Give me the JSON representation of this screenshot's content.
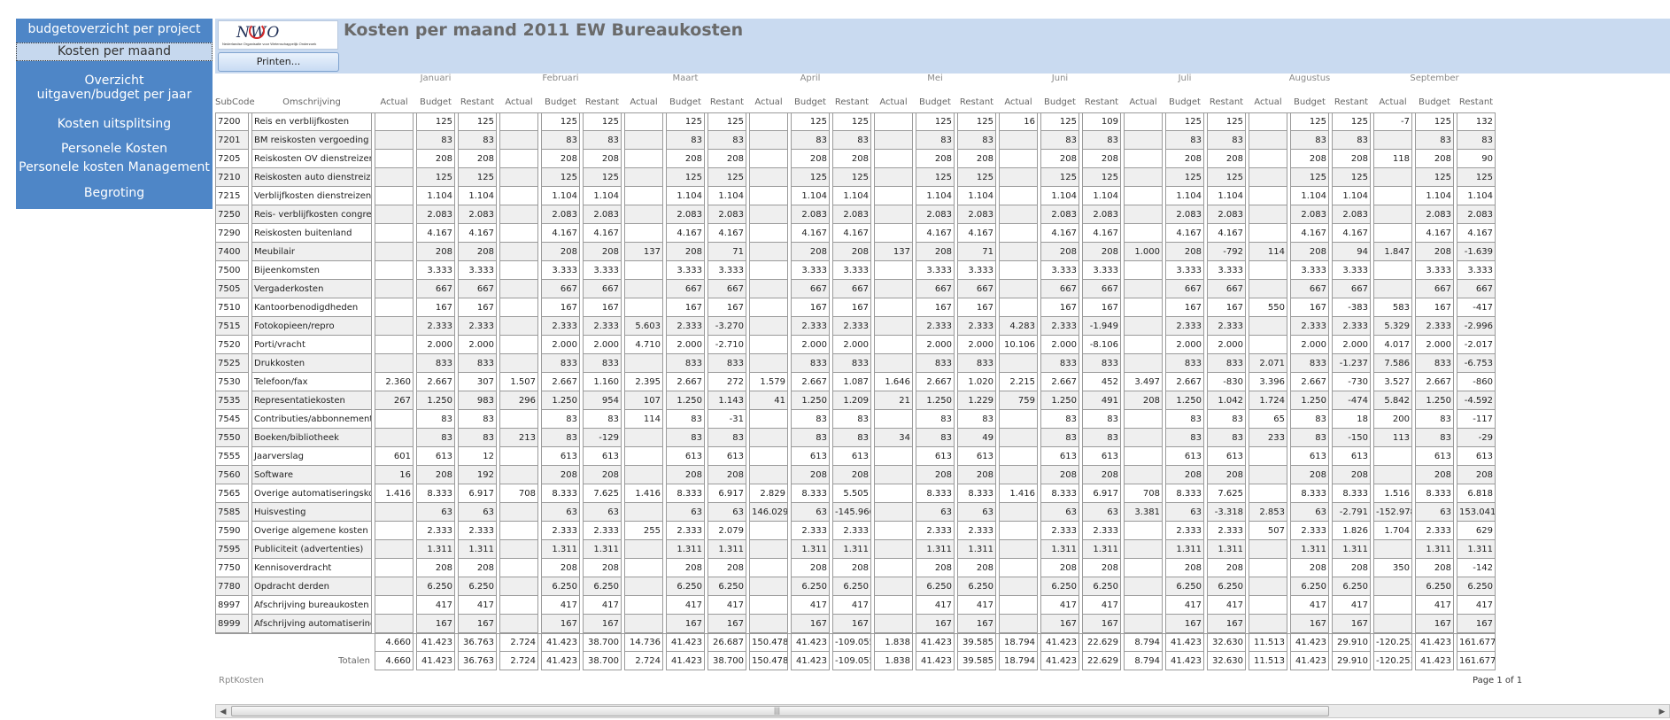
{
  "nav": {
    "items": [
      {
        "label": "budgetoverzicht per project",
        "active": false
      },
      {
        "label": "Kosten per maand",
        "active": true
      },
      {
        "label": "Overzicht uitgaven/budget per jaar",
        "active": false
      },
      {
        "label": "Kosten uitsplitsing",
        "active": false
      },
      {
        "label": "Personele Kosten",
        "active": false
      },
      {
        "label": "Personele kosten Management",
        "active": false
      },
      {
        "label": "Begroting",
        "active": false
      }
    ]
  },
  "header": {
    "logo_text": "NWO",
    "logo_subtitle": "Nederlandse Organisatie voor Wetenschappelijk Onderzoek",
    "title": "Kosten per maand 2011 EW Bureaukosten",
    "print_label": "Printen..."
  },
  "report": {
    "months": [
      "Januari",
      "Februari",
      "Maart",
      "April",
      "Mei",
      "Juni",
      "Juli",
      "Augustus",
      "September"
    ],
    "col_headers": {
      "subcode": "SubCode",
      "omschrijving": "Omschrijving",
      "actual": "Actual",
      "budget": "Budget",
      "restant": "Restant"
    },
    "rows": [
      {
        "code": "7200",
        "desc": "Reis en verblijfkosten",
        "v": [
          "",
          "125",
          "125",
          "",
          "125",
          "125",
          "",
          "125",
          "125",
          "",
          "125",
          "125",
          "",
          "125",
          "125",
          "16",
          "125",
          "109",
          "",
          "125",
          "125",
          "",
          "125",
          "125",
          "-7",
          "125",
          "132"
        ]
      },
      {
        "code": "7201",
        "desc": "BM reiskosten vergoeding",
        "v": [
          "",
          "83",
          "83",
          "",
          "83",
          "83",
          "",
          "83",
          "83",
          "",
          "83",
          "83",
          "",
          "83",
          "83",
          "",
          "83",
          "83",
          "",
          "83",
          "83",
          "",
          "83",
          "83",
          "",
          "83",
          "83"
        ]
      },
      {
        "code": "7205",
        "desc": "Reiskosten OV dienstreizen",
        "v": [
          "",
          "208",
          "208",
          "",
          "208",
          "208",
          "",
          "208",
          "208",
          "",
          "208",
          "208",
          "",
          "208",
          "208",
          "",
          "208",
          "208",
          "",
          "208",
          "208",
          "",
          "208",
          "208",
          "118",
          "208",
          "90"
        ]
      },
      {
        "code": "7210",
        "desc": "Reiskosten auto dienstreizen",
        "v": [
          "",
          "125",
          "125",
          "",
          "125",
          "125",
          "",
          "125",
          "125",
          "",
          "125",
          "125",
          "",
          "125",
          "125",
          "",
          "125",
          "125",
          "",
          "125",
          "125",
          "",
          "125",
          "125",
          "",
          "125",
          "125"
        ]
      },
      {
        "code": "7215",
        "desc": "Verblijfkosten dienstreizen",
        "v": [
          "",
          "1.104",
          "1.104",
          "",
          "1.104",
          "1.104",
          "",
          "1.104",
          "1.104",
          "",
          "1.104",
          "1.104",
          "",
          "1.104",
          "1.104",
          "",
          "1.104",
          "1.104",
          "",
          "1.104",
          "1.104",
          "",
          "1.104",
          "1.104",
          "",
          "1.104",
          "1.104"
        ]
      },
      {
        "code": "7250",
        "desc": "Reis- verblijfkosten congressen",
        "v": [
          "",
          "2.083",
          "2.083",
          "",
          "2.083",
          "2.083",
          "",
          "2.083",
          "2.083",
          "",
          "2.083",
          "2.083",
          "",
          "2.083",
          "2.083",
          "",
          "2.083",
          "2.083",
          "",
          "2.083",
          "2.083",
          "",
          "2.083",
          "2.083",
          "",
          "2.083",
          "2.083"
        ]
      },
      {
        "code": "7290",
        "desc": "Reiskosten buitenland",
        "v": [
          "",
          "4.167",
          "4.167",
          "",
          "4.167",
          "4.167",
          "",
          "4.167",
          "4.167",
          "",
          "4.167",
          "4.167",
          "",
          "4.167",
          "4.167",
          "",
          "4.167",
          "4.167",
          "",
          "4.167",
          "4.167",
          "",
          "4.167",
          "4.167",
          "",
          "4.167",
          "4.167"
        ]
      },
      {
        "code": "7400",
        "desc": "Meubilair",
        "v": [
          "",
          "208",
          "208",
          "",
          "208",
          "208",
          "137",
          "208",
          "71",
          "",
          "208",
          "208",
          "137",
          "208",
          "71",
          "",
          "208",
          "208",
          "1.000",
          "208",
          "-792",
          "114",
          "208",
          "94",
          "1.847",
          "208",
          "-1.639"
        ]
      },
      {
        "code": "7500",
        "desc": "Bijeenkomsten",
        "v": [
          "",
          "3.333",
          "3.333",
          "",
          "3.333",
          "3.333",
          "",
          "3.333",
          "3.333",
          "",
          "3.333",
          "3.333",
          "",
          "3.333",
          "3.333",
          "",
          "3.333",
          "3.333",
          "",
          "3.333",
          "3.333",
          "",
          "3.333",
          "3.333",
          "",
          "3.333",
          "3.333"
        ]
      },
      {
        "code": "7505",
        "desc": "Vergaderkosten",
        "v": [
          "",
          "667",
          "667",
          "",
          "667",
          "667",
          "",
          "667",
          "667",
          "",
          "667",
          "667",
          "",
          "667",
          "667",
          "",
          "667",
          "667",
          "",
          "667",
          "667",
          "",
          "667",
          "667",
          "",
          "667",
          "667"
        ]
      },
      {
        "code": "7510",
        "desc": "Kantoorbenodigdheden",
        "v": [
          "",
          "167",
          "167",
          "",
          "167",
          "167",
          "",
          "167",
          "167",
          "",
          "167",
          "167",
          "",
          "167",
          "167",
          "",
          "167",
          "167",
          "",
          "167",
          "167",
          "550",
          "167",
          "-383",
          "583",
          "167",
          "-417"
        ]
      },
      {
        "code": "7515",
        "desc": "Fotokopieen/repro",
        "v": [
          "",
          "2.333",
          "2.333",
          "",
          "2.333",
          "2.333",
          "5.603",
          "2.333",
          "-3.270",
          "",
          "2.333",
          "2.333",
          "",
          "2.333",
          "2.333",
          "4.283",
          "2.333",
          "-1.949",
          "",
          "2.333",
          "2.333",
          "",
          "2.333",
          "2.333",
          "5.329",
          "2.333",
          "-2.996"
        ]
      },
      {
        "code": "7520",
        "desc": "Porti/vracht",
        "v": [
          "",
          "2.000",
          "2.000",
          "",
          "2.000",
          "2.000",
          "4.710",
          "2.000",
          "-2.710",
          "",
          "2.000",
          "2.000",
          "",
          "2.000",
          "2.000",
          "10.106",
          "2.000",
          "-8.106",
          "",
          "2.000",
          "2.000",
          "",
          "2.000",
          "2.000",
          "4.017",
          "2.000",
          "-2.017"
        ]
      },
      {
        "code": "7525",
        "desc": "Drukkosten",
        "v": [
          "",
          "833",
          "833",
          "",
          "833",
          "833",
          "",
          "833",
          "833",
          "",
          "833",
          "833",
          "",
          "833",
          "833",
          "",
          "833",
          "833",
          "",
          "833",
          "833",
          "2.071",
          "833",
          "-1.237",
          "7.586",
          "833",
          "-6.753"
        ]
      },
      {
        "code": "7530",
        "desc": "Telefoon/fax",
        "v": [
          "2.360",
          "2.667",
          "307",
          "1.507",
          "2.667",
          "1.160",
          "2.395",
          "2.667",
          "272",
          "1.579",
          "2.667",
          "1.087",
          "1.646",
          "2.667",
          "1.020",
          "2.215",
          "2.667",
          "452",
          "3.497",
          "2.667",
          "-830",
          "3.396",
          "2.667",
          "-730",
          "3.527",
          "2.667",
          "-860"
        ]
      },
      {
        "code": "7535",
        "desc": "Representatiekosten",
        "v": [
          "267",
          "1.250",
          "983",
          "296",
          "1.250",
          "954",
          "107",
          "1.250",
          "1.143",
          "41",
          "1.250",
          "1.209",
          "21",
          "1.250",
          "1.229",
          "759",
          "1.250",
          "491",
          "208",
          "1.250",
          "1.042",
          "1.724",
          "1.250",
          "-474",
          "5.842",
          "1.250",
          "-4.592"
        ]
      },
      {
        "code": "7545",
        "desc": "Contributies/abbonnementen",
        "v": [
          "",
          "83",
          "83",
          "",
          "83",
          "83",
          "114",
          "83",
          "-31",
          "",
          "83",
          "83",
          "",
          "83",
          "83",
          "",
          "83",
          "83",
          "",
          "83",
          "83",
          "65",
          "83",
          "18",
          "200",
          "83",
          "-117"
        ]
      },
      {
        "code": "7550",
        "desc": "Boeken/bibliotheek",
        "v": [
          "",
          "83",
          "83",
          "213",
          "83",
          "-129",
          "",
          "83",
          "83",
          "",
          "83",
          "83",
          "34",
          "83",
          "49",
          "",
          "83",
          "83",
          "",
          "83",
          "83",
          "233",
          "83",
          "-150",
          "113",
          "83",
          "-29"
        ]
      },
      {
        "code": "7555",
        "desc": "Jaarverslag",
        "v": [
          "601",
          "613",
          "12",
          "",
          "613",
          "613",
          "",
          "613",
          "613",
          "",
          "613",
          "613",
          "",
          "613",
          "613",
          "",
          "613",
          "613",
          "",
          "613",
          "613",
          "",
          "613",
          "613",
          "",
          "613",
          "613"
        ]
      },
      {
        "code": "7560",
        "desc": "Software",
        "v": [
          "16",
          "208",
          "192",
          "",
          "208",
          "208",
          "",
          "208",
          "208",
          "",
          "208",
          "208",
          "",
          "208",
          "208",
          "",
          "208",
          "208",
          "",
          "208",
          "208",
          "",
          "208",
          "208",
          "",
          "208",
          "208"
        ]
      },
      {
        "code": "7565",
        "desc": "Overige automatiseringskosten",
        "v": [
          "1.416",
          "8.333",
          "6.917",
          "708",
          "8.333",
          "7.625",
          "1.416",
          "8.333",
          "6.917",
          "2.829",
          "8.333",
          "5.505",
          "",
          "8.333",
          "8.333",
          "1.416",
          "8.333",
          "6.917",
          "708",
          "8.333",
          "7.625",
          "",
          "8.333",
          "8.333",
          "1.516",
          "8.333",
          "6.818"
        ]
      },
      {
        "code": "7585",
        "desc": "Huisvesting",
        "v": [
          "",
          "63",
          "63",
          "",
          "63",
          "63",
          "",
          "63",
          "63",
          "146.029",
          "63",
          "-145.966",
          "",
          "63",
          "63",
          "",
          "63",
          "63",
          "3.381",
          "63",
          "-3.318",
          "2.853",
          "63",
          "-2.791",
          "-152.978",
          "63",
          "153.041"
        ]
      },
      {
        "code": "7590",
        "desc": "Overige algemene kosten",
        "v": [
          "",
          "2.333",
          "2.333",
          "",
          "2.333",
          "2.333",
          "255",
          "2.333",
          "2.079",
          "",
          "2.333",
          "2.333",
          "",
          "2.333",
          "2.333",
          "",
          "2.333",
          "2.333",
          "",
          "2.333",
          "2.333",
          "507",
          "2.333",
          "1.826",
          "1.704",
          "2.333",
          "629"
        ]
      },
      {
        "code": "7595",
        "desc": "Publiciteit (advertenties)",
        "v": [
          "",
          "1.311",
          "1.311",
          "",
          "1.311",
          "1.311",
          "",
          "1.311",
          "1.311",
          "",
          "1.311",
          "1.311",
          "",
          "1.311",
          "1.311",
          "",
          "1.311",
          "1.311",
          "",
          "1.311",
          "1.311",
          "",
          "1.311",
          "1.311",
          "",
          "1.311",
          "1.311"
        ]
      },
      {
        "code": "7750",
        "desc": "Kennisoverdracht",
        "v": [
          "",
          "208",
          "208",
          "",
          "208",
          "208",
          "",
          "208",
          "208",
          "",
          "208",
          "208",
          "",
          "208",
          "208",
          "",
          "208",
          "208",
          "",
          "208",
          "208",
          "",
          "208",
          "208",
          "350",
          "208",
          "-142"
        ]
      },
      {
        "code": "7780",
        "desc": "Opdracht derden",
        "v": [
          "",
          "6.250",
          "6.250",
          "",
          "6.250",
          "6.250",
          "",
          "6.250",
          "6.250",
          "",
          "6.250",
          "6.250",
          "",
          "6.250",
          "6.250",
          "",
          "6.250",
          "6.250",
          "",
          "6.250",
          "6.250",
          "",
          "6.250",
          "6.250",
          "",
          "6.250",
          "6.250"
        ]
      },
      {
        "code": "8997",
        "desc": "Afschrijving bureaukosten",
        "v": [
          "",
          "417",
          "417",
          "",
          "417",
          "417",
          "",
          "417",
          "417",
          "",
          "417",
          "417",
          "",
          "417",
          "417",
          "",
          "417",
          "417",
          "",
          "417",
          "417",
          "",
          "417",
          "417",
          "",
          "417",
          "417"
        ]
      },
      {
        "code": "8999",
        "desc": "Afschrijving automatisering",
        "v": [
          "",
          "167",
          "167",
          "",
          "167",
          "167",
          "",
          "167",
          "167",
          "",
          "167",
          "167",
          "",
          "167",
          "167",
          "",
          "167",
          "167",
          "",
          "167",
          "167",
          "",
          "167",
          "167",
          "",
          "167",
          "167"
        ]
      }
    ],
    "subtotal": [
      "4.660",
      "41.423",
      "36.763",
      "2.724",
      "41.423",
      "38.700",
      "14.736",
      "41.423",
      "26.687",
      "150.478",
      "41.423",
      "-109.055",
      "1.838",
      "41.423",
      "39.585",
      "18.794",
      "41.423",
      "22.629",
      "8.794",
      "41.423",
      "32.630",
      "11.513",
      "41.423",
      "29.910",
      "-120.253",
      "41.423",
      "161.677"
    ],
    "totals_label": "Totalen",
    "totals": [
      "4.660",
      "41.423",
      "36.763",
      "2.724",
      "41.423",
      "38.700",
      "2.724",
      "41.423",
      "38.700",
      "150.478",
      "41.423",
      "-109.055",
      "1.838",
      "41.423",
      "39.585",
      "18.794",
      "41.423",
      "22.629",
      "8.794",
      "41.423",
      "32.630",
      "11.513",
      "41.423",
      "29.910",
      "-120.253",
      "41.423",
      "161.677"
    ]
  },
  "footer": {
    "report_name": "RptKosten",
    "page_info": "Page 1 of 1"
  },
  "scrollbar": {
    "left_arrow": "◀",
    "right_arrow": "▶",
    "grip": "|||"
  }
}
